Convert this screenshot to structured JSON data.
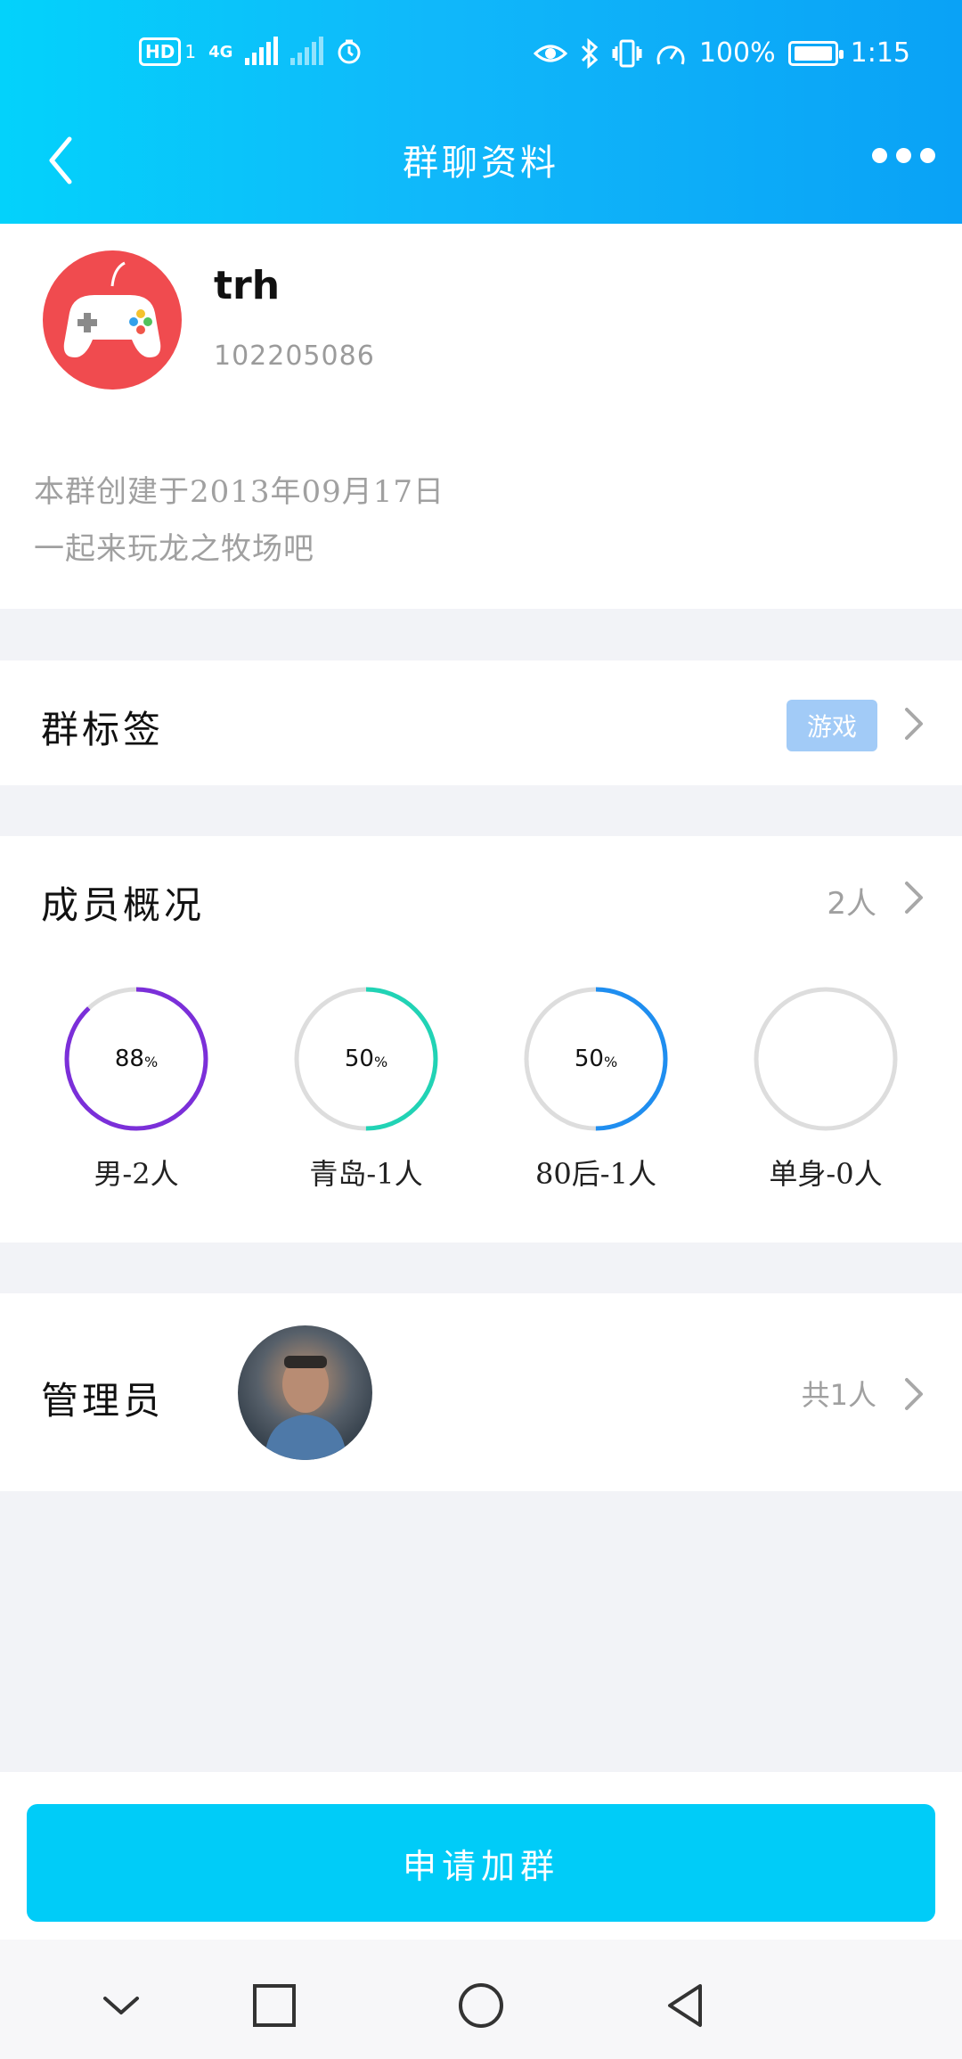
{
  "status_bar": {
    "hd": "HD",
    "sim": "1",
    "network": "4G",
    "battery_pct": "100%",
    "time": "1:15",
    "icons": [
      "hd-icon",
      "signal-icon",
      "signal-icon",
      "timer-icon",
      "eye-icon",
      "bluetooth-icon",
      "vibrate-icon",
      "speed-icon",
      "battery-icon"
    ]
  },
  "header": {
    "title": "群聊资料"
  },
  "group": {
    "name": "trh",
    "id": "102205086",
    "created": "本群创建于2013年09月17日",
    "intro": "一起来玩龙之牧场吧"
  },
  "tags": {
    "label": "群标签",
    "tag": "游戏"
  },
  "members": {
    "label": "成员概况",
    "count": "2人",
    "stats": [
      {
        "percent": "88",
        "unit": "%",
        "label": "男-2人",
        "value": 0.88,
        "color": "#7b2fd9"
      },
      {
        "percent": "50",
        "unit": "%",
        "label": "青岛-1人",
        "value": 0.5,
        "color": "#21d3b5"
      },
      {
        "percent": "50",
        "unit": "%",
        "label": "80后-1人",
        "value": 0.5,
        "color": "#1f8ef0"
      },
      {
        "percent": "",
        "unit": "",
        "label": "单身-0人",
        "value": 0,
        "color": "#dddddd"
      }
    ]
  },
  "admins": {
    "label": "管理员",
    "count": "共1人"
  },
  "join": {
    "label": "申请加群"
  }
}
